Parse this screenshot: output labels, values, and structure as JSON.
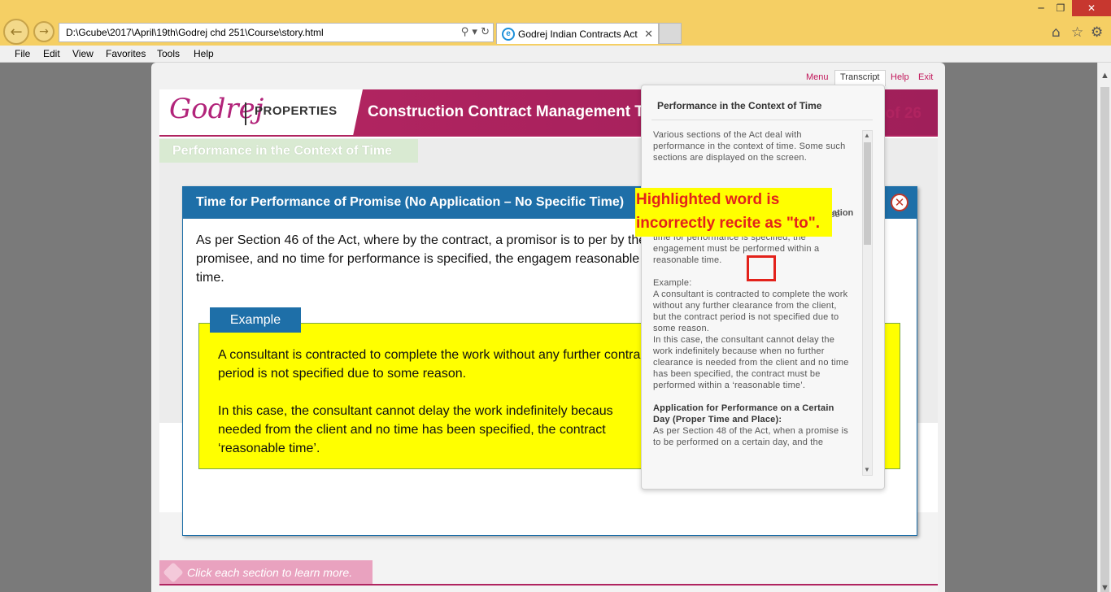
{
  "browser": {
    "address": "D:\\Gcube\\2017\\April\\19th\\Godrej chd 251\\Course\\story.html",
    "tab_title": "Godrej Indian Contracts Act",
    "menu": [
      "File",
      "Edit",
      "View",
      "Favorites",
      "Tools",
      "Help"
    ]
  },
  "player": {
    "nav": {
      "menu": "Menu",
      "transcript": "Transcript",
      "help": "Help",
      "exit": "Exit"
    }
  },
  "banner": {
    "logo_script": "Godrej",
    "logo_text": "PROPERTIES",
    "course_title": "Construction Contract Management Tra",
    "page_count": "of 26"
  },
  "slide": {
    "section_title": "Performance in the Context of Time",
    "footer_tip": "Click each section to learn more."
  },
  "popup": {
    "title": "Time for Performance of Promise (No Application – No Specific Time)",
    "body": "As per Section 46 of the Act, where by the contract, a promisor is to per by the promisee, and no time for performance is specified, the engagem reasonable time.",
    "example_label": "Example",
    "example_p1": "A consultant is contracted to complete the work without any further contract period is not specified due to some reason.",
    "example_p2": "In this case, the consultant cannot delay the work indefinitely becaus needed from the client and no time has been specified, the contract ‘reasonable time’."
  },
  "transcript": {
    "title": "Performance in the Context of Time",
    "p1": "Various sections of the Act deal with performance in the context of time. Some such sections are displayed on the screen.",
    "p2_tail": "ation",
    "p3": "As per Section 46 of the Act, where by the contract, a promisor is to perform his promise without application by the promisee, and no time for performance is specified, the engagement must be performed within a reasonable time.",
    "p4_label": "Example:",
    "p4": "A consultant is contracted to complete the work without any further clearance from the client, but the contract period is not specified due to some reason.",
    "p5": "In this case, the consultant cannot delay the work indefinitely because when no further clearance is needed from the client and no time has been specified, the contract must be performed within a ‘reasonable time’.",
    "p6_heading": "Application for Performance on a Certain Day (Proper Time and Place):",
    "p6": "As per Section 48 of the Act, when a promise is to be performed on a certain day, and the"
  },
  "annotation": {
    "line1": "Highlighted word is",
    "line2": "incorrectly recite as \"to\"."
  }
}
